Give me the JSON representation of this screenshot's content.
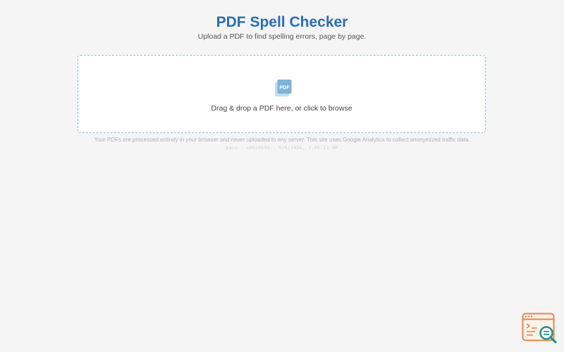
{
  "header": {
    "title": "PDF Spell Checker",
    "subtitle": "Upload a PDF to find spelling errors, page by page."
  },
  "dropzone": {
    "icon": "pdf-file-icon",
    "icon_label": "PDF",
    "prompt": "Drag & drop a PDF here, or click to browse"
  },
  "footer": {
    "privacy_note": "Your PDFs are processed entirely in your browser and never uploaded to any server. This site uses Google Analytics to collect anonymized traffic data.",
    "build_branch": "main",
    "build_hash": "e0928b95",
    "build_time": "5/6/2026, 2:06:13 AM",
    "separator": "·"
  },
  "corner_widget": {
    "icon": "code-search-icon"
  },
  "colors": {
    "title": "#2a6eb4",
    "dropzone_border": "#8fc0e4",
    "pdf_icon": "#7bb3de",
    "widget_orange": "#e8854a",
    "widget_teal": "#2a8f8a"
  }
}
